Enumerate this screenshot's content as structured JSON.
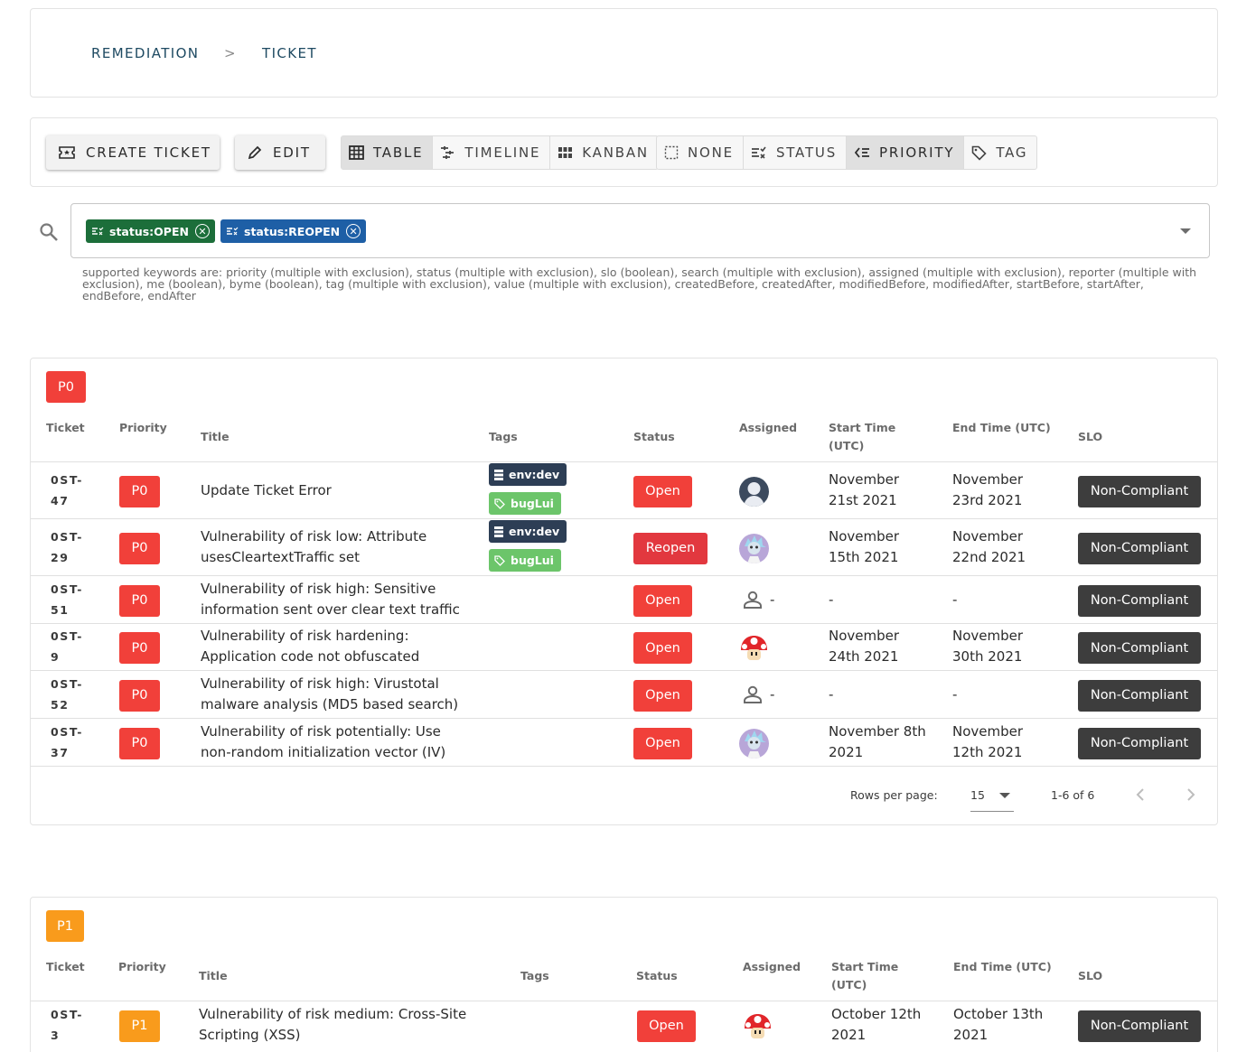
{
  "breadcrumb": {
    "items": [
      "REMEDIATION",
      "TICKET"
    ],
    "separator": ">"
  },
  "toolbar": {
    "create_label": "CREATE TICKET",
    "edit_label": "EDIT",
    "views": [
      "TABLE",
      "TIMELINE",
      "KANBAN"
    ],
    "active_view": "TABLE",
    "groupings": [
      "NONE",
      "STATUS",
      "PRIORITY",
      "TAG"
    ],
    "active_grouping": "PRIORITY"
  },
  "filter": {
    "chips": [
      {
        "label": "status:OPEN",
        "color": "#1c6e3a"
      },
      {
        "label": "status:REOPEN",
        "color": "#1e5fa6"
      }
    ],
    "hint": "supported keywords are: priority (multiple with exclusion), status (multiple with exclusion), slo (boolean), search (multiple with exclusion), assigned (multiple with exclusion), reporter (multiple with exclusion), me (boolean), byme (boolean), tag (multiple with exclusion), value (multiple with exclusion), createdBefore, createdAfter, modifiedBefore, modifiedAfter, startBefore, startAfter, endBefore, endAfter"
  },
  "columns": {
    "ticket": "Ticket",
    "priority": "Priority",
    "title": "Title",
    "tags": "Tags",
    "status": "Status",
    "assigned": "Assigned",
    "start": "Start Time (UTC)",
    "end": "End Time (UTC)",
    "slo": "SLO"
  },
  "colors": {
    "p0": "#f1403a",
    "p1": "#f99b1c",
    "open": "#f1403a",
    "reopen": "#e2383f",
    "slo": "#3d3d3d",
    "tag_env": "#2d3e55",
    "tag_bug": "#6cc56a"
  },
  "p0": {
    "label": "P0",
    "rows": [
      {
        "ticket": "0ST-47",
        "priority": "P0",
        "title": "Update Ticket Error",
        "tags": [
          "env:dev",
          "bugLui"
        ],
        "status": "Open",
        "assigned": "avatar-person",
        "start": "November 21st 2021",
        "end": "November 23rd 2021",
        "slo": "Non-Compliant"
      },
      {
        "ticket": "0ST-29",
        "priority": "P0",
        "title": "Vulnerability of risk low: Attribute usesCleartextTraffic set",
        "tags": [
          "env:dev",
          "bugLui"
        ],
        "status": "Reopen",
        "assigned": "avatar-rick",
        "start": "November 15th 2021",
        "end": "November 22nd 2021",
        "slo": "Non-Compliant"
      },
      {
        "ticket": "0ST-51",
        "priority": "P0",
        "title": "Vulnerability of risk high: Sensitive information sent over clear text traffic",
        "tags": [],
        "status": "Open",
        "assigned": "unassigned",
        "start": "-",
        "end": "-",
        "slo": "Non-Compliant"
      },
      {
        "ticket": "0ST-9",
        "priority": "P0",
        "title": "Vulnerability of risk hardening: Application code not obfuscated",
        "tags": [],
        "status": "Open",
        "assigned": "avatar-mushroom",
        "start": "November 24th 2021",
        "end": "November 30th 2021",
        "slo": "Non-Compliant"
      },
      {
        "ticket": "0ST-52",
        "priority": "P0",
        "title": "Vulnerability of risk high: Virustotal malware analysis (MD5 based search)",
        "tags": [],
        "status": "Open",
        "assigned": "unassigned",
        "start": "-",
        "end": "-",
        "slo": "Non-Compliant"
      },
      {
        "ticket": "0ST-37",
        "priority": "P0",
        "title": "Vulnerability of risk potentially: Use non-random initialization vector (IV)",
        "tags": [],
        "status": "Open",
        "assigned": "avatar-rick",
        "start": "November 8th 2021",
        "end": "November 12th 2021",
        "slo": "Non-Compliant"
      }
    ],
    "pagination": {
      "rows_label": "Rows per page:",
      "rows_value": "15",
      "range": "1-6 of 6"
    }
  },
  "p1": {
    "label": "P1",
    "rows": [
      {
        "ticket": "0ST-3",
        "priority": "P1",
        "title": "Vulnerability of risk medium: Cross-Site Scripting (XSS)",
        "tags": [],
        "status": "Open",
        "assigned": "avatar-mushroom",
        "start": "October 12th 2021",
        "end": "October 13th 2021",
        "slo": "Non-Compliant"
      }
    ]
  }
}
